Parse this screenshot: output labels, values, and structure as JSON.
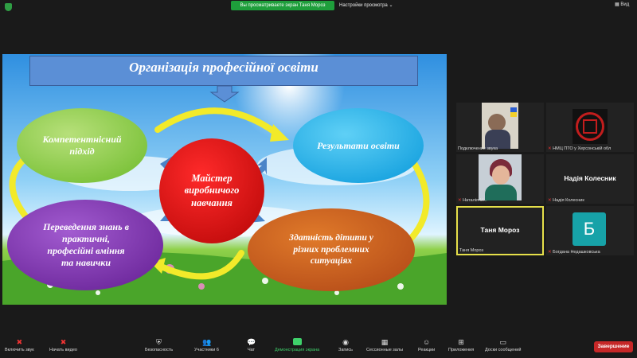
{
  "topbar": {
    "share_banner": "Вы просматриваете экран Таня Мороз",
    "view_options": "Настройки просмотра",
    "view_label": "Вид"
  },
  "slide": {
    "title": "Організація професійної освіти",
    "center": "Майстер\nвиробничого\nнавчання",
    "nodes": {
      "competence": "Компетентнісний\nпідхід",
      "results": "Результати освіти",
      "transfer": "Переведення знань в\nпрактичні,\nпрофесійні вміння\nта навички",
      "ability": "Здатність дітити у\nрізних проблемних\nситуаціях"
    }
  },
  "participants": [
    {
      "name": "Подключение звука",
      "muted": false,
      "type": "video"
    },
    {
      "name": "НМЦ ПТО у Херсонській обл",
      "muted": true,
      "type": "logo"
    },
    {
      "name": "Наталія М...",
      "muted": true,
      "type": "video"
    },
    {
      "name": "Надія Колесник",
      "muted": true,
      "type": "name",
      "big": "Надія Колесник"
    },
    {
      "name": "Таня Мороз",
      "muted": false,
      "type": "name",
      "big": "Таня Мороз"
    },
    {
      "name": "Богдана Недашковська",
      "muted": true,
      "type": "avatar",
      "initial": "Б",
      "avatar_color": "#17a2a8"
    }
  ],
  "toolbar": {
    "audio": "Включить звук",
    "video": "Начать видео",
    "security": "Безопасность",
    "participants": "Участники",
    "participants_count": "6",
    "chat": "Чат",
    "share": "Демонстрация экрана",
    "record": "Запись",
    "rooms": "Сессионные залы",
    "reactions": "Реакции",
    "apps": "Приложения",
    "whiteboard": "Доски сообщений",
    "end": "Завершение"
  },
  "colors": {
    "accent_green": "#1e9e3b",
    "end_red": "#c62828",
    "active_speaker": "#e6e04a"
  }
}
